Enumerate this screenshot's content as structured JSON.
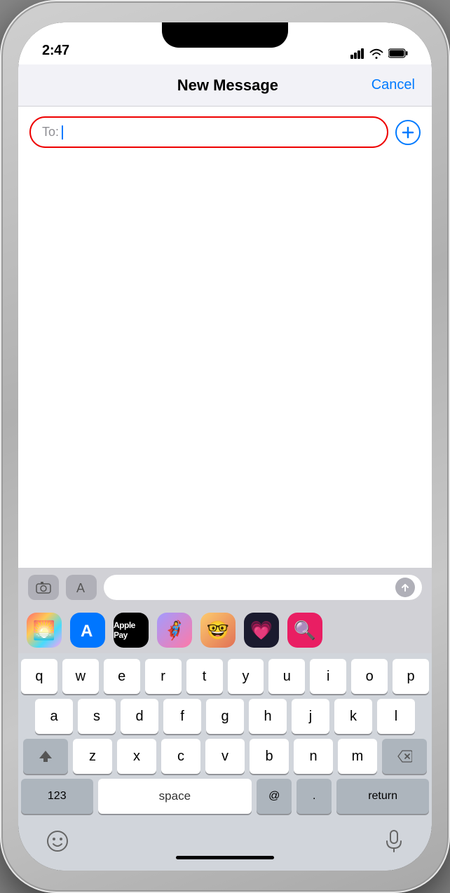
{
  "phone": {
    "status_bar": {
      "time": "2:47",
      "signal_label": "signal",
      "wifi_label": "wifi",
      "battery_label": "battery"
    },
    "nav": {
      "title": "New Message",
      "cancel_label": "Cancel"
    },
    "to_field": {
      "label": "To:",
      "placeholder": ""
    },
    "app_bar": {
      "camera_label": "camera",
      "appstore_label": "appstore",
      "send_label": "send"
    },
    "apps_strip": [
      {
        "name": "Photos",
        "emoji": "🌅"
      },
      {
        "name": "App Store",
        "emoji": "🅰"
      },
      {
        "name": "Apple Pay",
        "text": ""
      },
      {
        "name": "Memoji 1",
        "emoji": "🦸"
      },
      {
        "name": "Memoji 2",
        "emoji": "🤓"
      },
      {
        "name": "Heart",
        "emoji": "❤️"
      },
      {
        "name": "Globe Search",
        "emoji": "🔍"
      }
    ],
    "keyboard": {
      "row1": [
        "q",
        "w",
        "e",
        "r",
        "t",
        "y",
        "u",
        "i",
        "o",
        "p"
      ],
      "row2": [
        "a",
        "s",
        "d",
        "f",
        "g",
        "h",
        "j",
        "k",
        "l"
      ],
      "row3": [
        "z",
        "x",
        "c",
        "v",
        "b",
        "n",
        "m"
      ],
      "special": {
        "shift": "⇧",
        "delete": "⌫",
        "numbers": "123",
        "space": "space",
        "at": "@",
        "period": ".",
        "return": "return"
      }
    },
    "bottom_bar": {
      "emoji_label": "emoji",
      "mic_label": "microphone"
    }
  }
}
